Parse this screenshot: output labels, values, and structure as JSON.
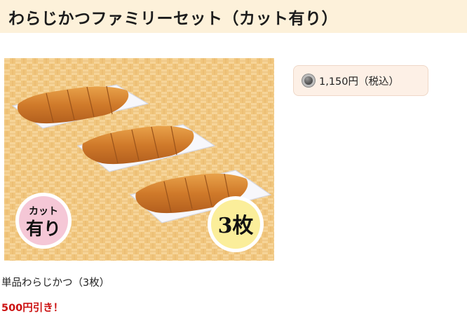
{
  "header": {
    "title": "わらじかつファミリーセット（カット有り）"
  },
  "image": {
    "badge_left_line1": "カット",
    "badge_left_line2": "有り",
    "badge_right_text": "3枚"
  },
  "price": {
    "text": "1,150円（税込）"
  },
  "description": "単品わらじかつ（3枚）",
  "discount": "500円引き！",
  "colors": {
    "header_bg": "#fdf1da",
    "discount": "#cc1111",
    "price_box_bg": "#fdf0e6"
  }
}
